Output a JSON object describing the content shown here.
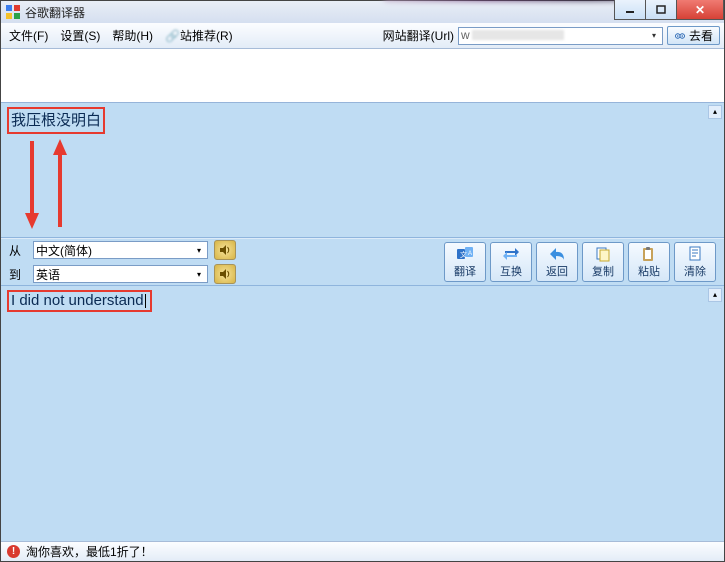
{
  "title": "谷歌翻译器",
  "menu": {
    "file": "文件(F)",
    "settings": "设置(S)",
    "help": "帮助(H)",
    "recommend": "站推荐(R)"
  },
  "urlbar": {
    "label": "网站翻译(Url)",
    "value": "w",
    "go": "去看"
  },
  "source_text": "我压根没明白",
  "lang": {
    "from_label": "从",
    "to_label": "到",
    "from_value": "中文(简体)",
    "to_value": "英语"
  },
  "buttons": {
    "translate": "翻译",
    "swap": "互换",
    "back": "返回",
    "copy": "复制",
    "paste": "粘贴",
    "clear": "清除"
  },
  "output_text": "I did not understand",
  "status_text": "淘你喜欢，最低1折了！"
}
